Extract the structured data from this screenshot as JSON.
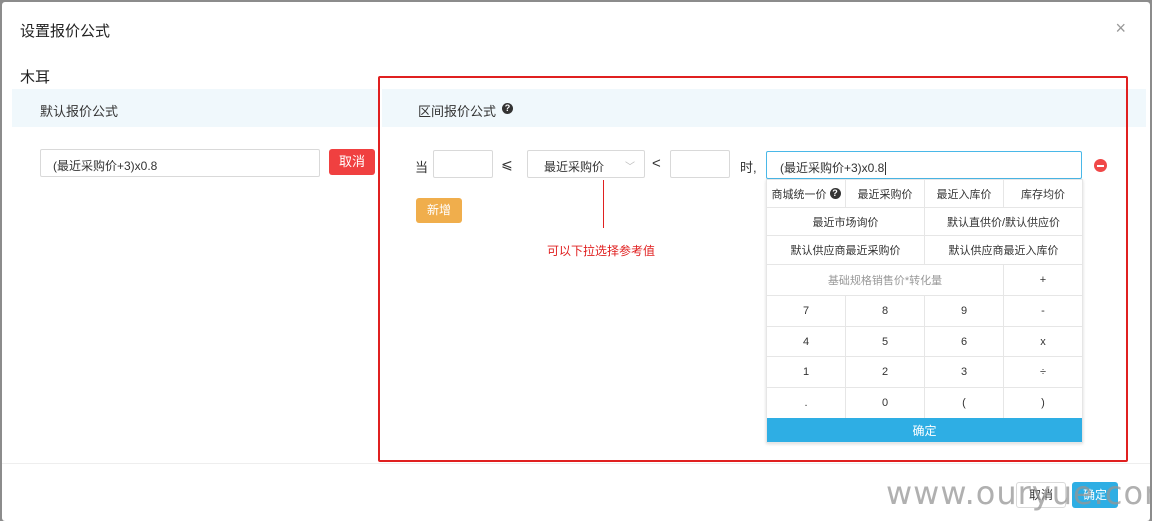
{
  "dialog": {
    "title": "设置报价公式",
    "close": "×"
  },
  "product_name": "木耳",
  "left": {
    "header": "默认报价公式",
    "formula_value": "(最近采购价+3)x0.8",
    "cancel_label": "取消"
  },
  "right": {
    "header": "区间报价公式",
    "help": "?",
    "rule": {
      "when_label": "当",
      "lower_value": "",
      "le_symbol": "⩽",
      "ref_select": "最近采购价",
      "lt_symbol": "<",
      "upper_value": "",
      "then_label": "时,",
      "formula_value": "(最近采购价+3)x0.8"
    },
    "add_label": "新增",
    "annotation": "可以下拉选择参考值"
  },
  "keypad": {
    "row1": [
      "商城统一价",
      "最近采购价",
      "最近入库价",
      "库存均价"
    ],
    "row2": [
      "最近市场询价",
      "默认直供价/默认供应价"
    ],
    "row3": [
      "默认供应商最近采购价",
      "默认供应商最近入库价"
    ],
    "row4": [
      "基础规格销售价*转化量",
      "+"
    ],
    "row5": [
      "7",
      "8",
      "9",
      "-"
    ],
    "row6": [
      "4",
      "5",
      "6",
      "x"
    ],
    "row7": [
      "1",
      "2",
      "3",
      "÷"
    ],
    "row8": [
      ".",
      "0",
      "(",
      ")"
    ],
    "confirm": "确定"
  },
  "footer": {
    "cancel": "取消",
    "ok": "确定"
  },
  "watermark": "www.ouryue.com"
}
